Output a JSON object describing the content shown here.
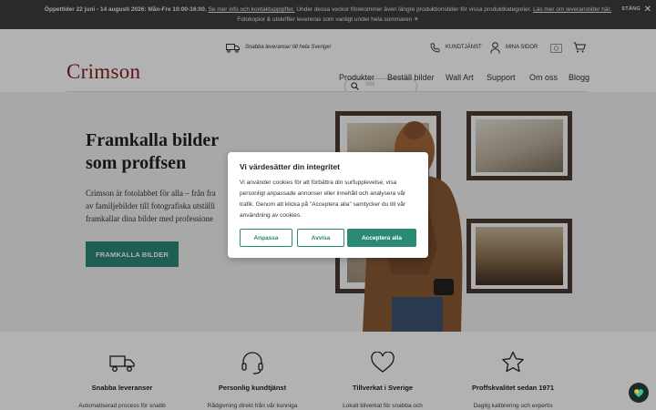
{
  "announcement": {
    "line1_start": "Öppettider 22 juni - 14 augusti 2026: Mån-Fre 10:00-16:00.",
    "line1_link1": "Se mer info och kontaktuppgifter.",
    "line1_middle": "Under dessa veckor förekommer även längre produktionstider för vissa produktkategorier.",
    "line1_link2": "Läs mer om leveranstider här.",
    "line2": "Fotokopior & utskrifter levereras som vanligt under hela sommaren ☀",
    "close_label": "STÄNG"
  },
  "utility": {
    "delivery_text": "Snabba leveranser till hela Sverige!",
    "search_placeholder": "Sök",
    "support_label": "KUNDTJÄNST",
    "account_label": "MINA SIDOR"
  },
  "brand": {
    "logo": "Crimson",
    "color": "#8a1c24"
  },
  "nav": {
    "items": [
      "Produkter",
      "Beställ bilder",
      "Wall Art",
      "Support",
      "Om oss",
      "Blogg"
    ]
  },
  "hero": {
    "headline_line1": "Framkalla bilder",
    "headline_line2": "som proffsen",
    "body_line1": "Crimson är fotolabbet för alla – från fra",
    "body_line2": "av familjebilder till fotografiska utställi",
    "body_line3": "framkallar dina bilder med professione",
    "cta_label": "FRAMKALLA BILDER",
    "accent": "#2a8a74"
  },
  "cookie": {
    "title": "Vi värdesätter din integritet",
    "text": "Vi använder cookies för att förbättra din surfupplevelse, visa personligt anpassade annonser eller innehåll och analysera vår trafik. Genom att klicka på \"Acceptera alla\" samtycker du till vår användning av cookies.",
    "customize": "Anpassa",
    "reject": "Avvisa",
    "accept_all": "Acceptera alla"
  },
  "features": [
    {
      "icon": "truck-icon",
      "title": "Snabba leveranser",
      "desc": "Automatiserad process för snabb"
    },
    {
      "icon": "headset-icon",
      "title": "Personlig kundtjänst",
      "desc": "Rådgivning direkt från vår kunniga"
    },
    {
      "icon": "heart-icon",
      "title": "Tillverkat i Sverige",
      "desc": "Lokalt tillverkat för snabba och"
    },
    {
      "icon": "star-icon",
      "title": "Proffskvalitet sedan 1971",
      "desc": "Daglig kalibrering och expertis"
    }
  ]
}
